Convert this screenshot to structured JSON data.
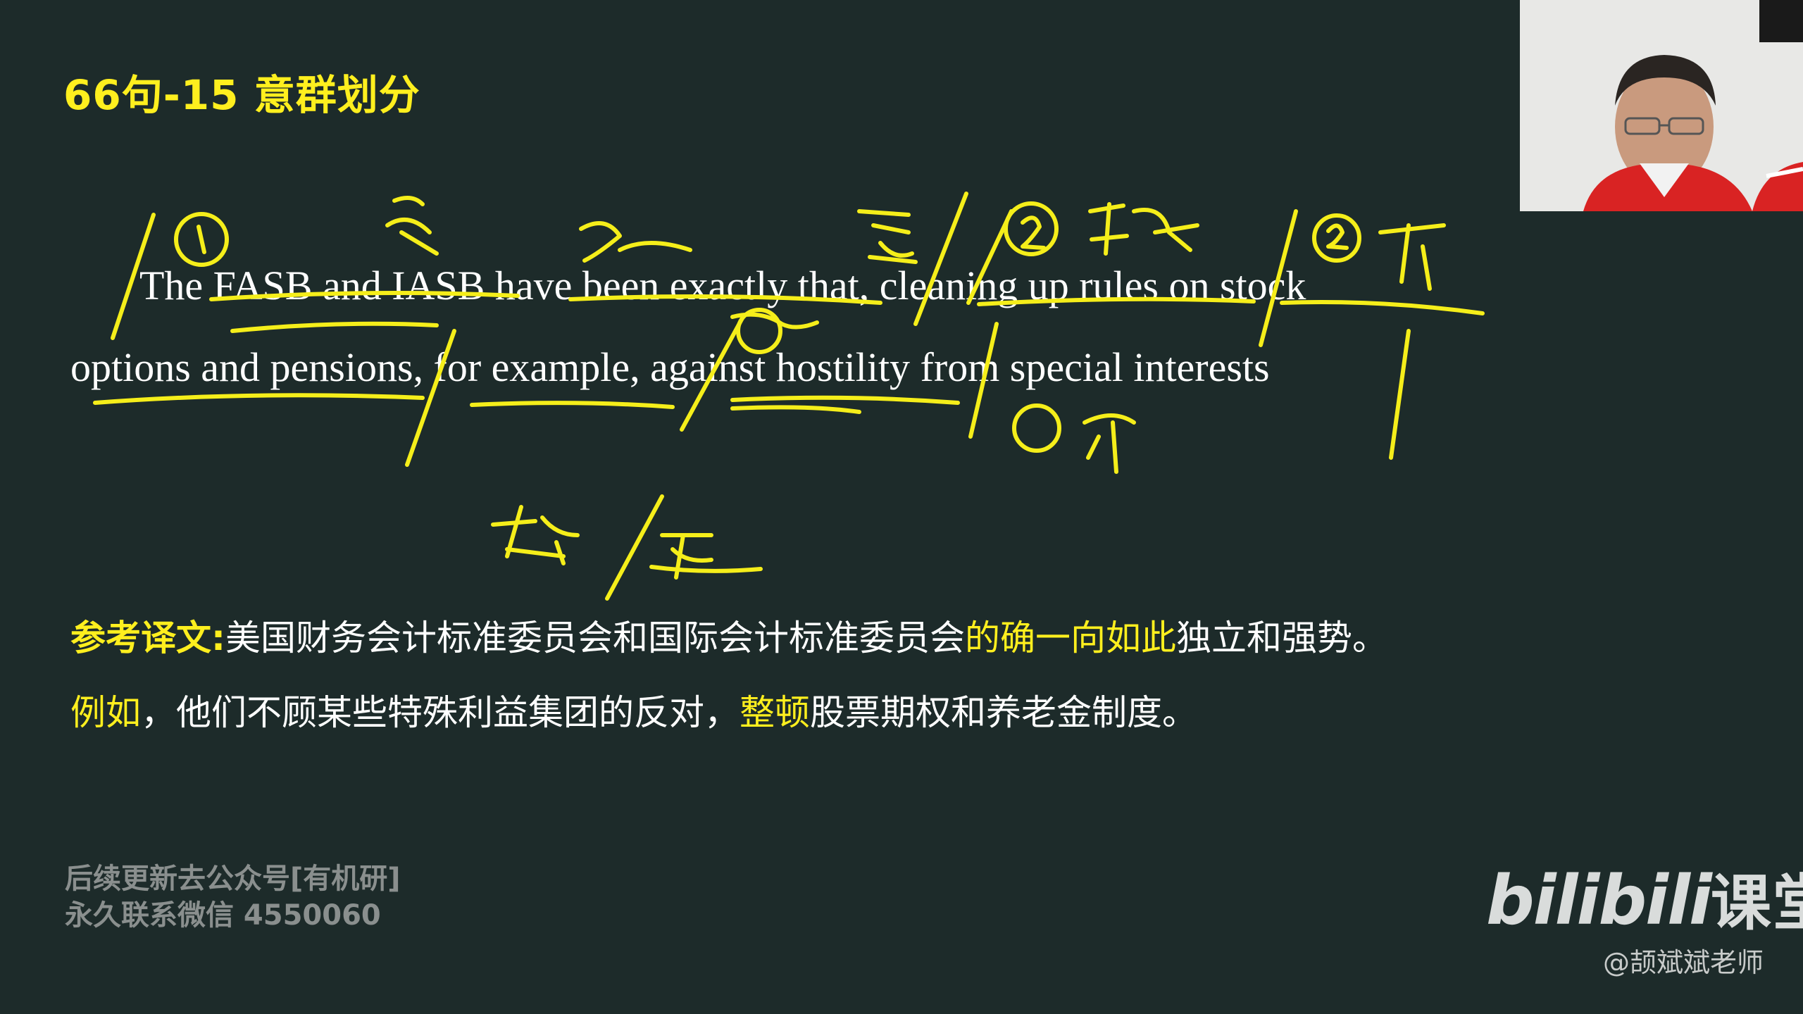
{
  "slide": {
    "title": "66句-15 意群划分",
    "sentence_line1": "The FASB and IASB have been exactly that, cleaning up rules on stock",
    "sentence_line2": "options and pensions, for example, against hostility from special interests",
    "translation": {
      "label": "参考译文:",
      "line1_a": "美国财务会计标准委员会和国际会计标准委员会",
      "line1_hl": "的确一向如此",
      "line1_b": "独立和强势。",
      "line2_hl1": "例如",
      "line2_a": "，他们不顾某些特殊利益集团的反对，",
      "line2_hl2": "整顿",
      "line2_b": "股票期权和养老金制度。"
    }
  },
  "footer": {
    "notice_line1": "后续更新去公众号[有机研]",
    "notice_line2": "永久联系微信 4550060"
  },
  "watermark": {
    "brand_latin": "bilibili",
    "brand_cn": "课堂",
    "credit": "@颉斌斌老师"
  },
  "colors": {
    "background": "#1d2b2a",
    "highlight": "#ffef1e",
    "ink": "#f5ee1a",
    "text": "#ffffff"
  }
}
